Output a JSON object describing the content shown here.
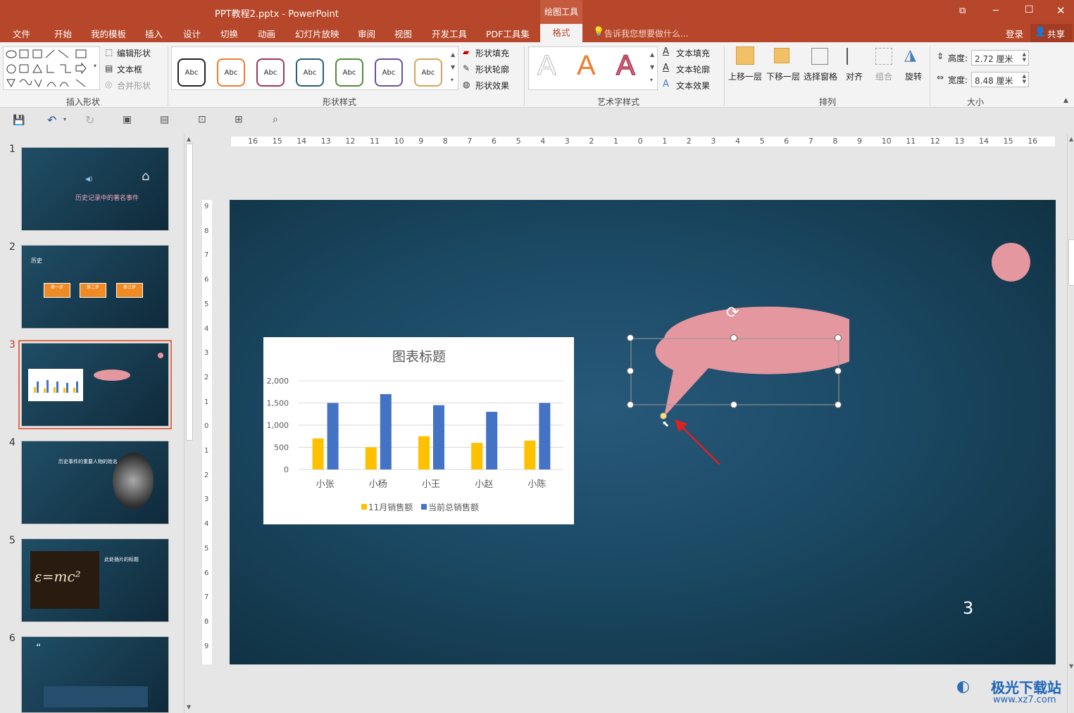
{
  "window": {
    "title": "PPT教程2.pptx - PowerPoint",
    "context_tab_group": "绘图工具",
    "minimize_label": "─",
    "maximize_label": "☐",
    "close_label": "✕",
    "restore_label": "⧉"
  },
  "menu": {
    "tabs": [
      "文件",
      "开始",
      "我的模板",
      "插入",
      "设计",
      "切换",
      "动画",
      "幻灯片放映",
      "审阅",
      "视图",
      "开发工具",
      "PDF工具集",
      "格式"
    ],
    "active_tab": "格式",
    "tell_me": "告诉我您想要做什么...",
    "login": "登录",
    "share": "共享"
  },
  "ribbon": {
    "insert_shapes": {
      "label": "插入形状",
      "edit_shape": "编辑形状",
      "text_box": "文本框",
      "merge_shapes": "合并形状"
    },
    "shape_styles": {
      "label": "形状样式",
      "sample": "Abc",
      "fill": "形状填充",
      "outline": "形状轮廓",
      "effects": "形状效果",
      "colors": [
        "#222222",
        "#ed7d31",
        "#a5364f",
        "#255e7e",
        "#4f8c3a",
        "#6b4f9a",
        "#d6a35a"
      ]
    },
    "wordart_styles": {
      "label": "艺术字样式",
      "sample": "A",
      "text_fill": "文本填充",
      "text_outline": "文本轮廓",
      "text_effects": "文本效果"
    },
    "arrange": {
      "label": "排列",
      "bring_forward": "上移一层",
      "send_backward": "下移一层",
      "selection_pane": "选择窗格",
      "align": "对齐",
      "group": "组合",
      "rotate": "旋转"
    },
    "size": {
      "label": "大小",
      "height_label": "高度:",
      "height_value": "2.72 厘米",
      "width_label": "宽度:",
      "width_value": "8.48 厘米"
    }
  },
  "slides": [
    {
      "num": "1",
      "title": "历史记录中的著名事件"
    },
    {
      "num": "2",
      "title": "历史",
      "steps": [
        "第一步",
        "第二步",
        "第三步"
      ]
    },
    {
      "num": "3"
    },
    {
      "num": "4",
      "title": "历史事件的重要人物的姓名"
    },
    {
      "num": "5",
      "title": "此处插片的标题"
    },
    {
      "num": "6"
    }
  ],
  "selected_slide": "3",
  "ruler": {
    "horizontal": [
      "16",
      "15",
      "14",
      "13",
      "12",
      "11",
      "10",
      "9",
      "8",
      "7",
      "6",
      "5",
      "4",
      "3",
      "2",
      "1",
      "0",
      "1",
      "2",
      "3",
      "4",
      "5",
      "6",
      "7",
      "8",
      "9",
      "10",
      "11",
      "12",
      "13",
      "14",
      "15",
      "16"
    ],
    "vertical": [
      "9",
      "8",
      "7",
      "6",
      "5",
      "4",
      "3",
      "2",
      "1",
      "0",
      "1",
      "2",
      "3",
      "4",
      "5",
      "6",
      "7",
      "8",
      "9"
    ]
  },
  "slide": {
    "page_number": "3"
  },
  "chart_data": {
    "type": "bar",
    "title": "图表标题",
    "categories": [
      "小张",
      "小杨",
      "小王",
      "小赵",
      "小陈"
    ],
    "series": [
      {
        "name": "11月销售额",
        "color": "#ffc000",
        "values": [
          700,
          500,
          750,
          600,
          650
        ]
      },
      {
        "name": "当前总销售额",
        "color": "#4472c4",
        "values": [
          1500,
          1700,
          1450,
          1300,
          1500
        ]
      }
    ],
    "ylim": [
      0,
      2000
    ],
    "yticks": [
      "0",
      "500",
      "1,000",
      "1,500",
      "2,000"
    ],
    "grid": true,
    "legend": "bottom"
  },
  "callout": {
    "fill": "#e4979f"
  },
  "circle": {
    "fill": "#e4979f"
  },
  "watermark": {
    "text": "极光下载站",
    "url": "www.xz7.com"
  }
}
